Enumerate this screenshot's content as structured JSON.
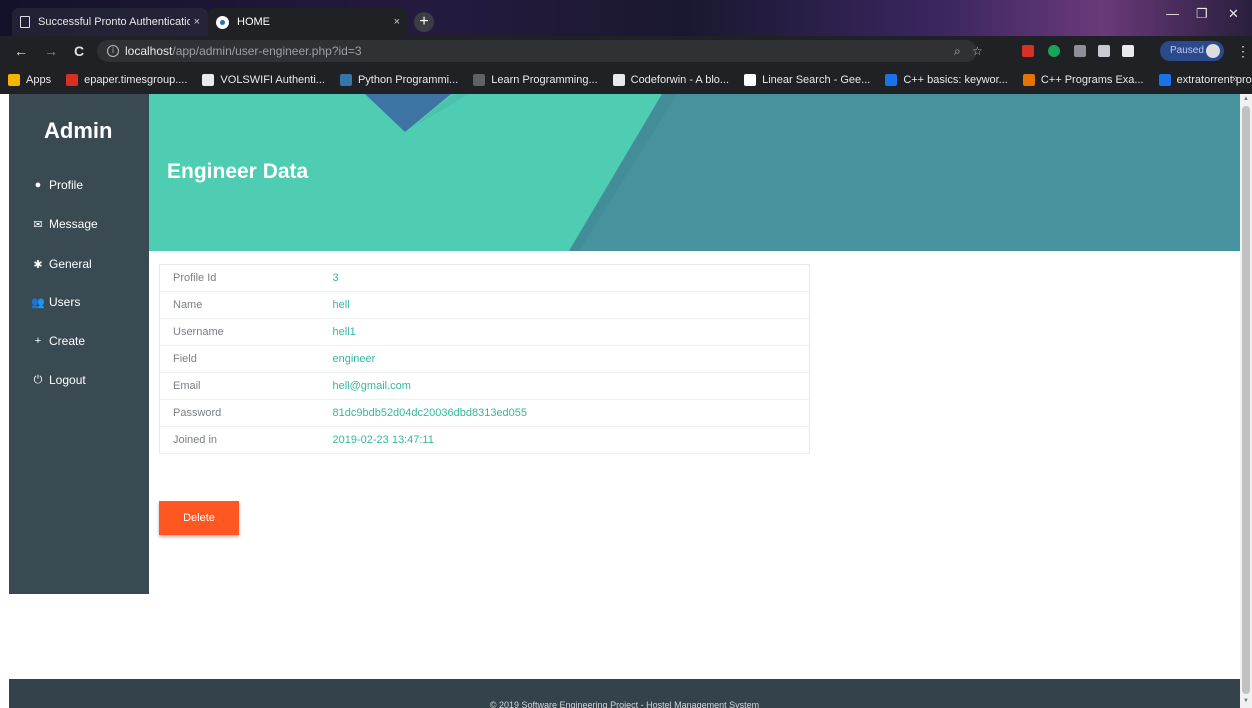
{
  "browser": {
    "tabs": [
      {
        "title": "Successful Pronto Authentication",
        "close": "×"
      },
      {
        "title": "HOME",
        "close": "×"
      }
    ],
    "new_tab": "+",
    "window_controls": {
      "minimize": "—",
      "restore": "❐",
      "close": "✕"
    },
    "nav": {
      "back": "←",
      "forward": "→",
      "reload": "C"
    },
    "url_host": "localhost",
    "url_path": "/app/admin/user-engineer.php?id=3",
    "zoom_icon": "⌕",
    "star_icon": "☆",
    "profile_status": "Paused",
    "menu": "⋮",
    "bookmarks": [
      {
        "label": "Apps",
        "color": "#f4b400"
      },
      {
        "label": "epaper.timesgroup....",
        "color": "#d93025"
      },
      {
        "label": "VOLSWIFI Authenti...",
        "color": "#e8eaed"
      },
      {
        "label": "Python Programmi...",
        "color": "#3776ab"
      },
      {
        "label": "Learn Programming...",
        "color": "#5f6368"
      },
      {
        "label": "Codeforwin - A blo...",
        "color": "#e8eaed"
      },
      {
        "label": "Linear Search - Gee...",
        "color": "#ffffff"
      },
      {
        "label": "C++ basics: keywor...",
        "color": "#1a73e8"
      },
      {
        "label": "C++ Programs Exa...",
        "color": "#e37400"
      },
      {
        "label": "extratorrent proxy -...",
        "color": "#1a73e8"
      }
    ],
    "bookmarks_more": "»"
  },
  "sidebar": {
    "brand": "Admin",
    "items": [
      {
        "icon": "●",
        "label": "Profile"
      },
      {
        "icon": "✉",
        "label": "Message"
      },
      {
        "icon": "✱",
        "label": "General"
      },
      {
        "icon": "👥",
        "label": "Users"
      },
      {
        "icon": "+",
        "label": "Create"
      },
      {
        "icon": "⏻",
        "label": "Logout"
      }
    ]
  },
  "header": {
    "title": "Engineer Data"
  },
  "engineer": {
    "rows": [
      {
        "key": "Profile Id",
        "value": "3"
      },
      {
        "key": "Name",
        "value": "hell"
      },
      {
        "key": "Username",
        "value": "hell1"
      },
      {
        "key": "Field",
        "value": "engineer"
      },
      {
        "key": "Email",
        "value": "hell@gmail.com"
      },
      {
        "key": "Password",
        "value": "81dc9bdb52d04dc20036dbd8313ed055"
      },
      {
        "key": "Joined in",
        "value": "2019-02-23 13:47:11"
      }
    ]
  },
  "actions": {
    "delete_label": "Delete"
  },
  "footer": {
    "text": "© 2019 Software Engineering Project - Hostel Management System"
  },
  "colors": {
    "accent": "#4ecdb2",
    "value_text": "#33b7a2",
    "sidebar": "#3a4a53",
    "delete": "#ff5722"
  }
}
